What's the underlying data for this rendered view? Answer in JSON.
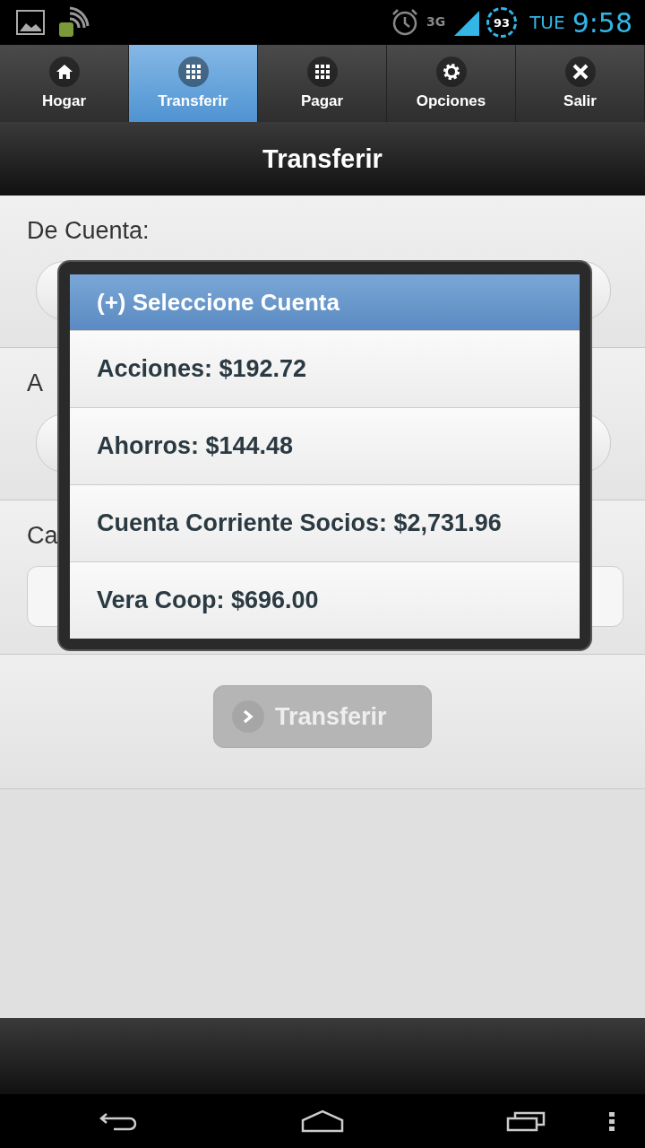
{
  "status_bar": {
    "day": "TUE",
    "time": "9:58",
    "battery": "93",
    "network": "3G"
  },
  "tabs": [
    {
      "label": "Hogar",
      "kind": "home",
      "selected": false
    },
    {
      "label": "Transferir",
      "kind": "grid",
      "selected": true
    },
    {
      "label": "Pagar",
      "kind": "grid",
      "selected": false
    },
    {
      "label": "Opciones",
      "kind": "gear",
      "selected": false
    },
    {
      "label": "Salir",
      "kind": "close",
      "selected": false
    }
  ],
  "header": {
    "title": "Transferir"
  },
  "form": {
    "fields": [
      {
        "label": "De Cuenta:",
        "kind": "select"
      },
      {
        "label": "A",
        "kind": "select"
      },
      {
        "label": "Ca",
        "kind": "text"
      }
    ],
    "submit": {
      "label": "Transferir",
      "disabled": true
    }
  },
  "popup": {
    "title": "(+) Seleccione Cuenta",
    "options": [
      "Acciones: $192.72",
      "Ahorros: $144.48",
      "Cuenta Corriente Socios: $2,731.96",
      "Vera Coop: $696.00"
    ]
  }
}
